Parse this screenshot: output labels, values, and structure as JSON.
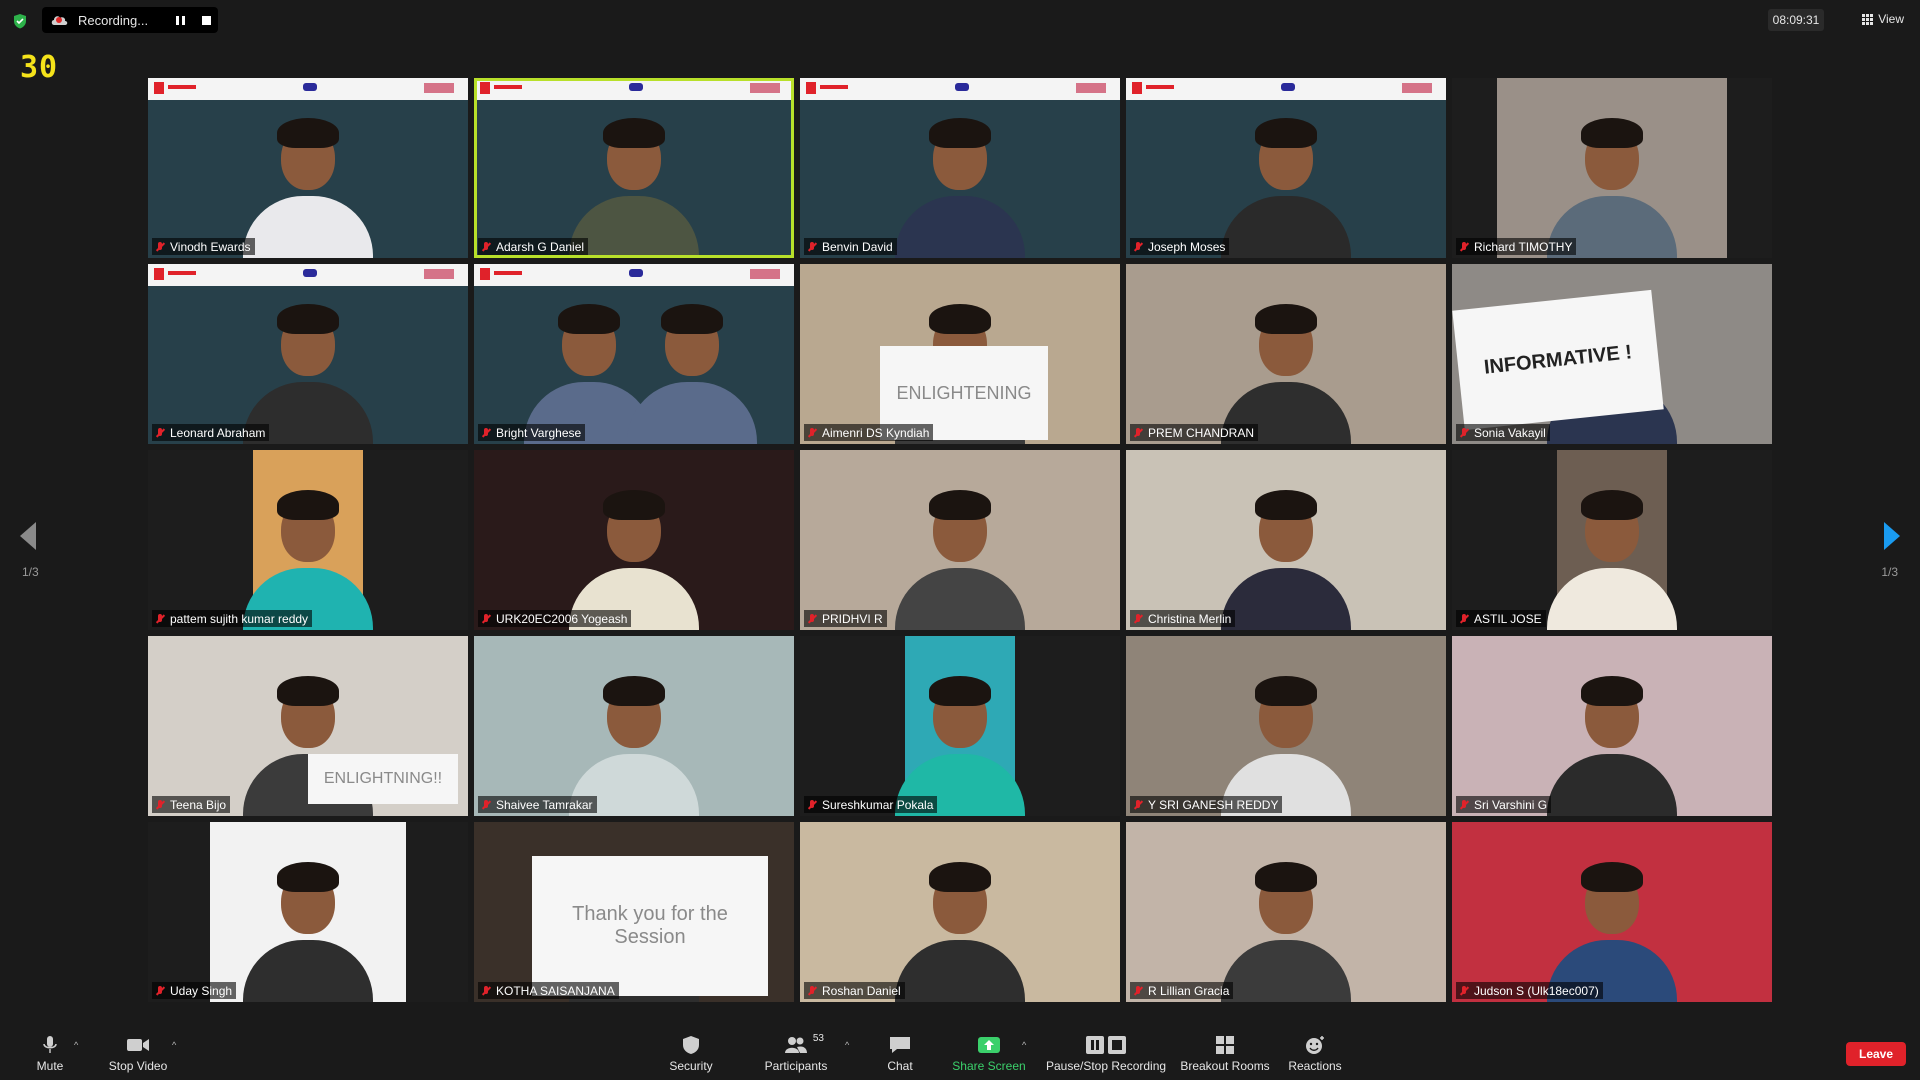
{
  "topbar": {
    "recording_label": "Recording...",
    "frame_counter": "30",
    "clock": "08:09:31",
    "view_label": "View"
  },
  "pager": {
    "left_label": "1/3",
    "right_label": "1/3"
  },
  "participants_tiles": [
    {
      "name": "Vinodh Ewards",
      "banner": true
    },
    {
      "name": "Adarsh G Daniel",
      "banner": true,
      "active": true
    },
    {
      "name": "Benvin David",
      "banner": true
    },
    {
      "name": "Joseph Moses",
      "banner": true
    },
    {
      "name": "Richard TIMOTHY"
    },
    {
      "name": "Leonard Abraham",
      "banner": true
    },
    {
      "name": "Bright Varghese",
      "banner": true
    },
    {
      "name": "Aimenri DS Kyndiah",
      "sign": "ENLIGHTENING"
    },
    {
      "name": "PREM CHANDRAN"
    },
    {
      "name": "Sonia Vakayil",
      "sign": "INFORMATIVE !"
    },
    {
      "name": "pattem sujith kumar reddy"
    },
    {
      "name": "URK20EC2006 Yogeash"
    },
    {
      "name": "PRIDHVI R"
    },
    {
      "name": "Christina Merlin"
    },
    {
      "name": "ASTIL JOSE"
    },
    {
      "name": "Teena Bijo",
      "sign": "ENLIGHTNING!!"
    },
    {
      "name": "Shaivee Tamrakar"
    },
    {
      "name": "Sureshkumar Pokala"
    },
    {
      "name": "Y SRI GANESH REDDY"
    },
    {
      "name": "Sri Varshini G"
    },
    {
      "name": "Uday Singh"
    },
    {
      "name": "KOTHA SAISANJANA",
      "sign": "Thank you for the Session"
    },
    {
      "name": "Roshan Daniel"
    },
    {
      "name": "R Lillian Gracia"
    },
    {
      "name": "Judson S (Ulk18ec007)"
    }
  ],
  "toolbar": {
    "mute": "Mute",
    "stop_video": "Stop Video",
    "security": "Security",
    "participants": "Participants",
    "participants_count": "53",
    "chat": "Chat",
    "share_screen": "Share Screen",
    "pause_stop_recording": "Pause/Stop Recording",
    "breakout_rooms": "Breakout Rooms",
    "reactions": "Reactions",
    "leave": "Leave"
  },
  "colors": {
    "background": "#1a1a1a",
    "active_speaker_border": "#b8e02a",
    "leave_button": "#e0222a",
    "share_screen_green": "#3bd06b",
    "next_page_arrow": "#1a9bf0"
  }
}
